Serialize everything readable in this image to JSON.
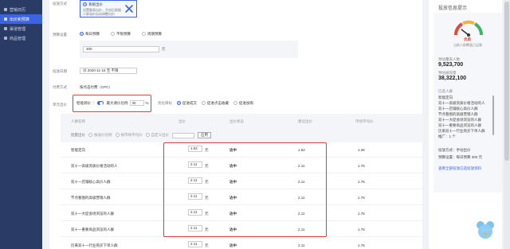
{
  "sidebar": {
    "items": [
      {
        "label": "营销日历",
        "active": false
      },
      {
        "label": "出价和预算",
        "active": true
      },
      {
        "label": "渠道管理",
        "active": false
      },
      {
        "label": "商品管理",
        "active": false
      }
    ]
  },
  "form": {
    "bid_mode_label": "投放方式",
    "bid_mode_card": {
      "option": "系统出价",
      "desc1": "设置最高出价，开启后根据",
      "desc2": "人群溢价自动调整出价"
    },
    "budget_label": "预算设置",
    "budget_options": [
      "每日预算",
      "不限预算",
      "周期预算"
    ],
    "budget_value": "300",
    "budget_unit": "元",
    "date_label": "投放日期",
    "date_value": "2020-11-15 至 不限",
    "pay_label": "付费方式",
    "pay_value": "按点击付费（CPC）",
    "bid_label": "单元出价",
    "smart_bid_label": "智能调价",
    "max_bid_label": "最大调价比例",
    "max_bid_value": "30",
    "max_bid_unit": "%",
    "optimize_label": "优化目标",
    "optimize_options": [
      "促进成交",
      "促进点击收藏",
      "促进加购"
    ],
    "table_headers": [
      "人群名称",
      "出价",
      "出价状态",
      "建议出价",
      "市场平均价"
    ],
    "batch_label": "批量出价",
    "batch_options": [
      "按溢价比例",
      "按市场平均价",
      "自定义出价"
    ],
    "batch_button": "应用"
  },
  "table_rows": [
    {
      "name": "智能定向",
      "bid": "1.52",
      "unit": "元",
      "status": "达中",
      "suggest": "1.52",
      "avg": "1.26"
    },
    {
      "name": "双十一高级资质价格活动的人",
      "bid": "2.11",
      "unit": "元",
      "status": "达中",
      "suggest": "2.11",
      "avg": "1.76"
    },
    {
      "name": "双十一店铺核心高价人群",
      "bid": "2.11",
      "unit": "元",
      "status": "达中",
      "suggest": "2.11",
      "avg": "1.76"
    },
    {
      "name": "节点看图的高级营销人群",
      "bid": "2.11",
      "unit": "元",
      "status": "达中",
      "suggest": "2.11",
      "avg": "1.76"
    },
    {
      "name": "双十一大促会场浏览的人群",
      "bid": "2.11",
      "unit": "元",
      "status": "达中",
      "suggest": "2.11",
      "avg": "1.76"
    },
    {
      "name": "双十一重要商品浏览的人群",
      "bid": "2.11",
      "unit": "元",
      "status": "达中",
      "suggest": "2.11",
      "avg": "1.76"
    },
    {
      "name": "历来双十一行业购买下单人群",
      "bid": "2.11",
      "unit": "元",
      "status": "达中",
      "suggest": "2.11",
      "avg": "1.76"
    }
  ],
  "right_panel": {
    "title": "投放信息提示",
    "gauge_label": "优质",
    "gauge_desc": "当前人群覆盖已足够",
    "stat1_label": "预估覆盖人数",
    "stat1_value": "9,523,700",
    "stat2_label": "预估展现量",
    "stat2_value": "38,322,100",
    "crowd_title": "已选人群",
    "crowd_items": [
      "智能定向",
      "双十一高级资质价格活动的人",
      "双十一店铺核心高价人群",
      "节点看图的高级营销人群",
      "双十一大促会场浏览的人群",
      "双十一重要商品浏览的人群",
      "历来双十一行业购买下单人群",
      "推广：1.个"
    ],
    "bid_mode": "投放方式：手动出价",
    "budget": "预算设置：每日预算 300 元",
    "link": "查看全部投放已选投放资料"
  },
  "colors": {
    "accent": "#3b63e6",
    "sidebar": "#2a3b66",
    "highlight": "#e03a3a"
  }
}
